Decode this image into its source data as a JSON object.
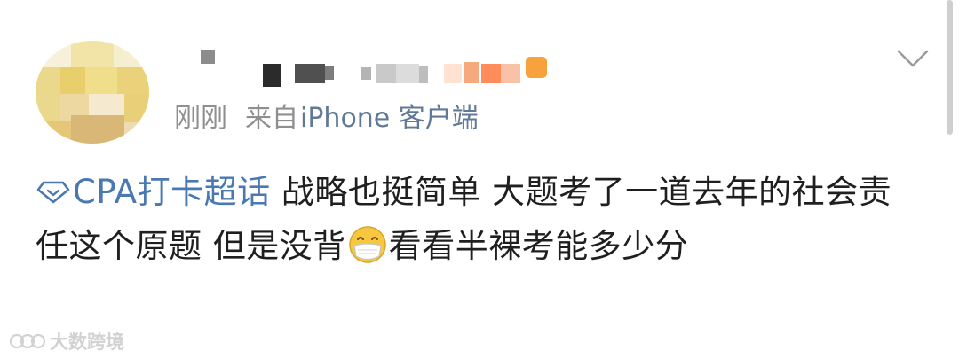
{
  "post": {
    "time": "刚刚",
    "source_prefix": "来自",
    "source_client": "iPhone 客户端",
    "topic": "CPA打卡超话",
    "text_part1": " 战略也挺简单 大题考了一道去年的社会责任这个原题 但是没背",
    "emoji": "mask-face-emoji",
    "text_part2": "看看半裸考能多少分"
  },
  "watermark": {
    "text": "大数跨境"
  },
  "icons": {
    "topic": "diamond-topic-icon",
    "more": "chevron-down-icon"
  },
  "colors": {
    "link": "#4a79b1",
    "meta": "#8f8f8f",
    "text": "#1f1f1f",
    "badge": "#f7a23c"
  }
}
